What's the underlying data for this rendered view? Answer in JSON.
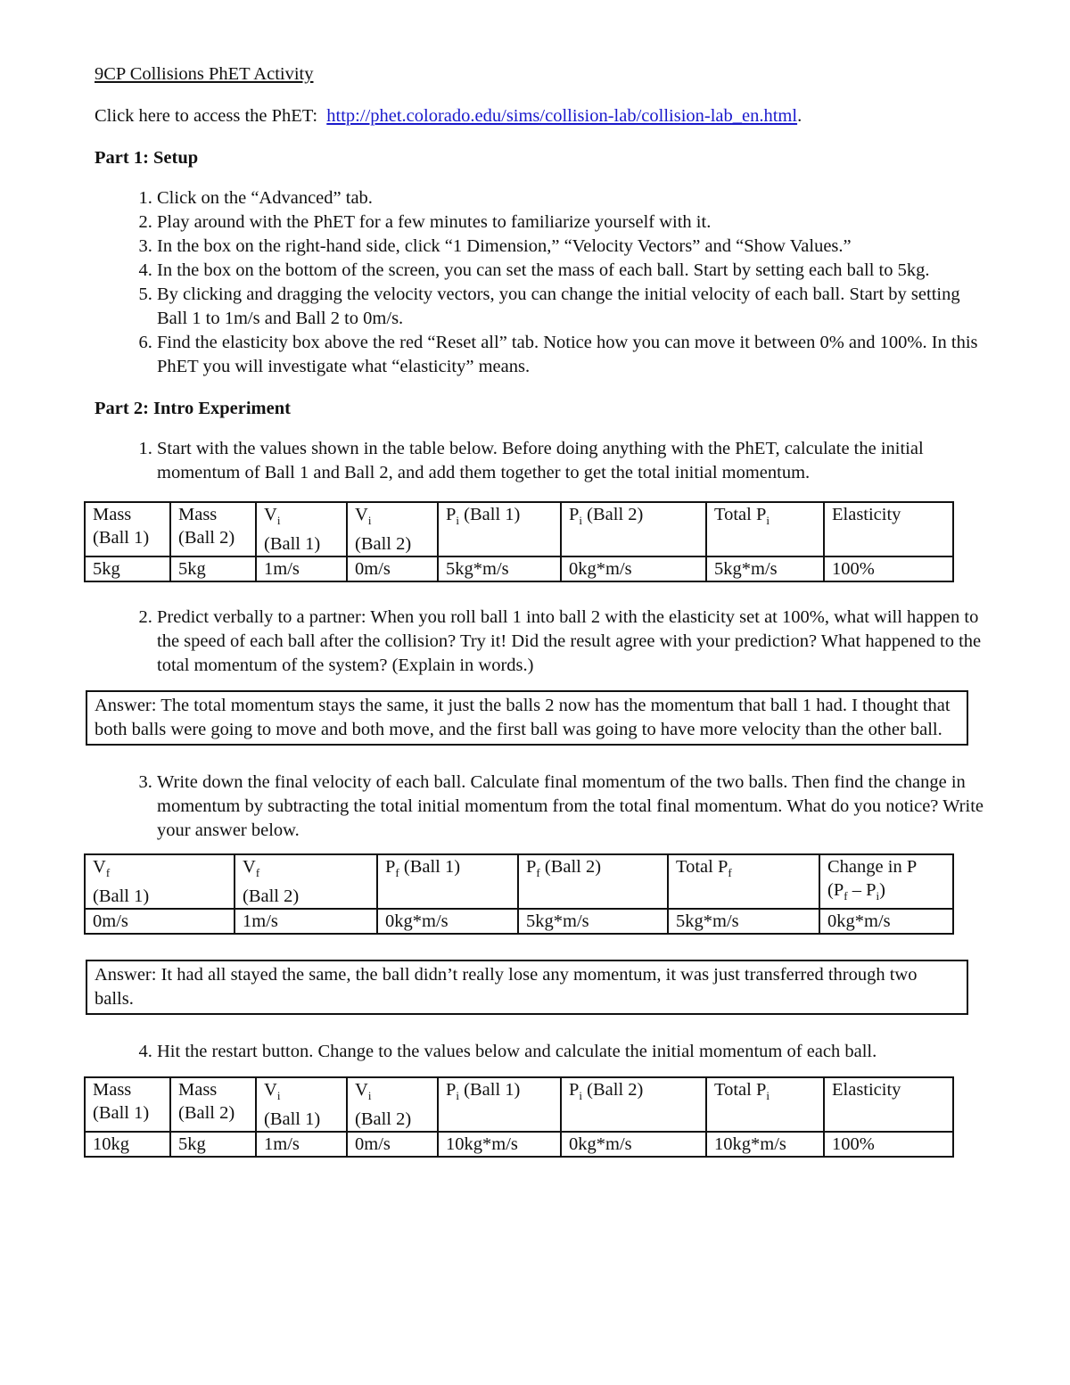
{
  "title": "9CP Collisions PhET Activity",
  "link_prefix": "Click here to access the PhET:",
  "link_url_text": "http://phet.colorado.edu/sims/collision-lab/collision-lab_en.html",
  "link_suffix": ".",
  "part1": {
    "heading": "Part 1: Setup",
    "items": [
      "Click on the “Advanced” tab.",
      "Play around with the PhET for a few minutes to familiarize yourself with it.",
      "In the box on the right-hand side, click “1 Dimension,” “Velocity Vectors” and “Show Values.”",
      "In the box on the bottom of the screen, you can set the mass of each ball. Start by setting each ball to 5kg.",
      "By clicking and dragging the velocity vectors, you can change the initial velocity of each ball. Start by setting Ball 1 to 1m/s and Ball 2 to 0m/s.",
      "Find the elasticity box above the red “Reset all” tab.  Notice how you can move it between 0% and 100%. In this PhET you will investigate what “elasticity” means."
    ]
  },
  "part2": {
    "heading": "Part 2: Intro Experiment",
    "q1": "Start with the values shown in the table below. Before doing anything with the PhET, calculate the initial momentum of Ball 1 and Ball 2, and add them together to get the total initial momentum.",
    "table1": {
      "headers": [
        "Mass (Ball 1)",
        "Mass (Ball 2)",
        "Vi (Ball 1)",
        "Vi (Ball 2)",
        "Pi (Ball 1)",
        "Pi (Ball 2)",
        "Total Pi",
        "Elasticity"
      ],
      "row": [
        "5kg",
        "5kg",
        "1m/s",
        "0m/s",
        "5kg*m/s",
        "0kg*m/s",
        "5kg*m/s",
        "100%"
      ]
    },
    "q2": "Predict verbally to a partner: When you roll ball 1 into ball 2 with the elasticity set at 100%, what will happen to the speed of each ball after the collision? Try it! Did the result agree with your prediction? What happened to the total momentum of the system? (Explain in words.)",
    "answer2": "Answer: The total momentum stays the same, it just the balls 2 now has the momentum that ball 1 had. I thought that both balls were going to move and both move, and the first ball was going to have more velocity than the other ball.",
    "q3": "Write down the final velocity of each ball. Calculate final momentum of the two balls. Then find the change in momentum by subtracting the total initial momentum from the total final momentum. What do you notice? Write your answer below.",
    "table2": {
      "headers": [
        "Vf (Ball 1)",
        "Vf (Ball 2)",
        "Pf (Ball 1)",
        "Pf (Ball 2)",
        "Total Pf",
        "Change in P (Pf – Pi)"
      ],
      "row": [
        "0m/s",
        "1m/s",
        "0kg*m/s",
        "5kg*m/s",
        "5kg*m/s",
        "0kg*m/s"
      ]
    },
    "answer3": "Answer: It had all stayed the same, the ball didn’t really lose any momentum, it was just transferred through two balls.",
    "q4": "Hit the restart button. Change to the values below and calculate the initial momentum of each ball.",
    "table3": {
      "row": [
        "10kg",
        "5kg",
        "1m/s",
        "0m/s",
        "10kg*m/s",
        "0kg*m/s",
        "10kg*m/s",
        "100%"
      ]
    }
  }
}
